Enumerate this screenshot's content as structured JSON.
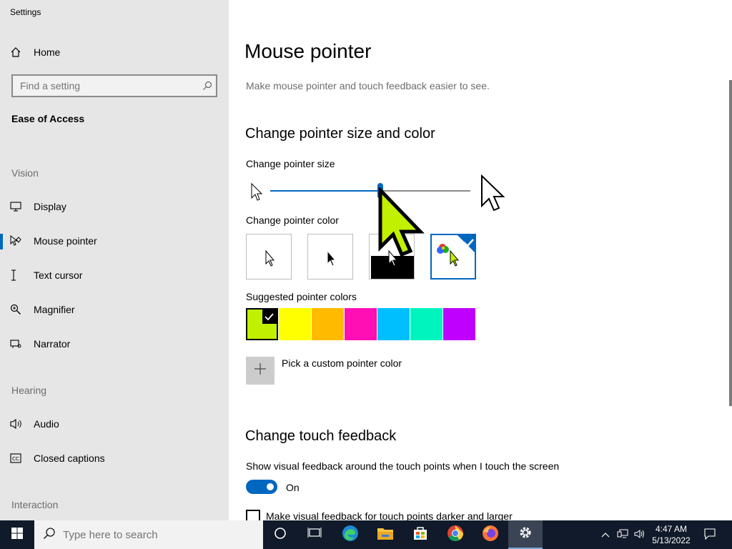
{
  "window": {
    "app_title": "Settings",
    "controls": [
      "minimize-icon",
      "restore-icon",
      "close-icon"
    ]
  },
  "sidebar": {
    "home_label": "Home",
    "search_placeholder": "Find a setting",
    "category": "Ease of Access",
    "sections": [
      {
        "header": "Vision",
        "items": [
          {
            "label": "Display",
            "icon": "display-icon"
          },
          {
            "label": "Mouse pointer",
            "icon": "mouse-pointer-icon",
            "active": true
          },
          {
            "label": "Text cursor",
            "icon": "text-cursor-icon"
          },
          {
            "label": "Magnifier",
            "icon": "magnifier-icon"
          },
          {
            "label": "Narrator",
            "icon": "narrator-icon"
          }
        ]
      },
      {
        "header": "Hearing",
        "items": [
          {
            "label": "Audio",
            "icon": "audio-icon"
          },
          {
            "label": "Closed captions",
            "icon": "closed-captions-icon"
          }
        ]
      },
      {
        "header": "Interaction",
        "items": []
      }
    ]
  },
  "main": {
    "title": "Mouse pointer",
    "description": "Make mouse pointer and touch feedback easier to see.",
    "pointer_section": {
      "heading": "Change pointer size and color",
      "size_label": "Change pointer size",
      "size_slider_level": 0.55,
      "color_label": "Change pointer color",
      "color_options": [
        "white",
        "black",
        "inverted",
        "custom"
      ],
      "selected_color_option": "custom",
      "suggested_label": "Suggested pointer colors",
      "suggested_colors": [
        "#c1f000",
        "#ffff00",
        "#ffbb00",
        "#ff0fb4",
        "#00bfff",
        "#00f5be",
        "#bf00ff"
      ],
      "selected_suggested": "#c1f000",
      "custom_label": "Pick a custom pointer color"
    },
    "touch_section": {
      "heading": "Change touch feedback",
      "show_feedback_label": "Show visual feedback around the touch points when I touch the screen",
      "toggle_state": "On",
      "darker_label": "Make visual feedback for touch points darker and larger"
    }
  },
  "taskbar": {
    "search_placeholder": "Type here to search",
    "apps": [
      "cortana-icon",
      "task-view-icon",
      "edge-icon",
      "file-explorer-icon",
      "store-icon",
      "chrome-icon",
      "firefox-icon",
      "settings-icon"
    ],
    "time": "4:47 AM",
    "date": "5/13/2022"
  }
}
